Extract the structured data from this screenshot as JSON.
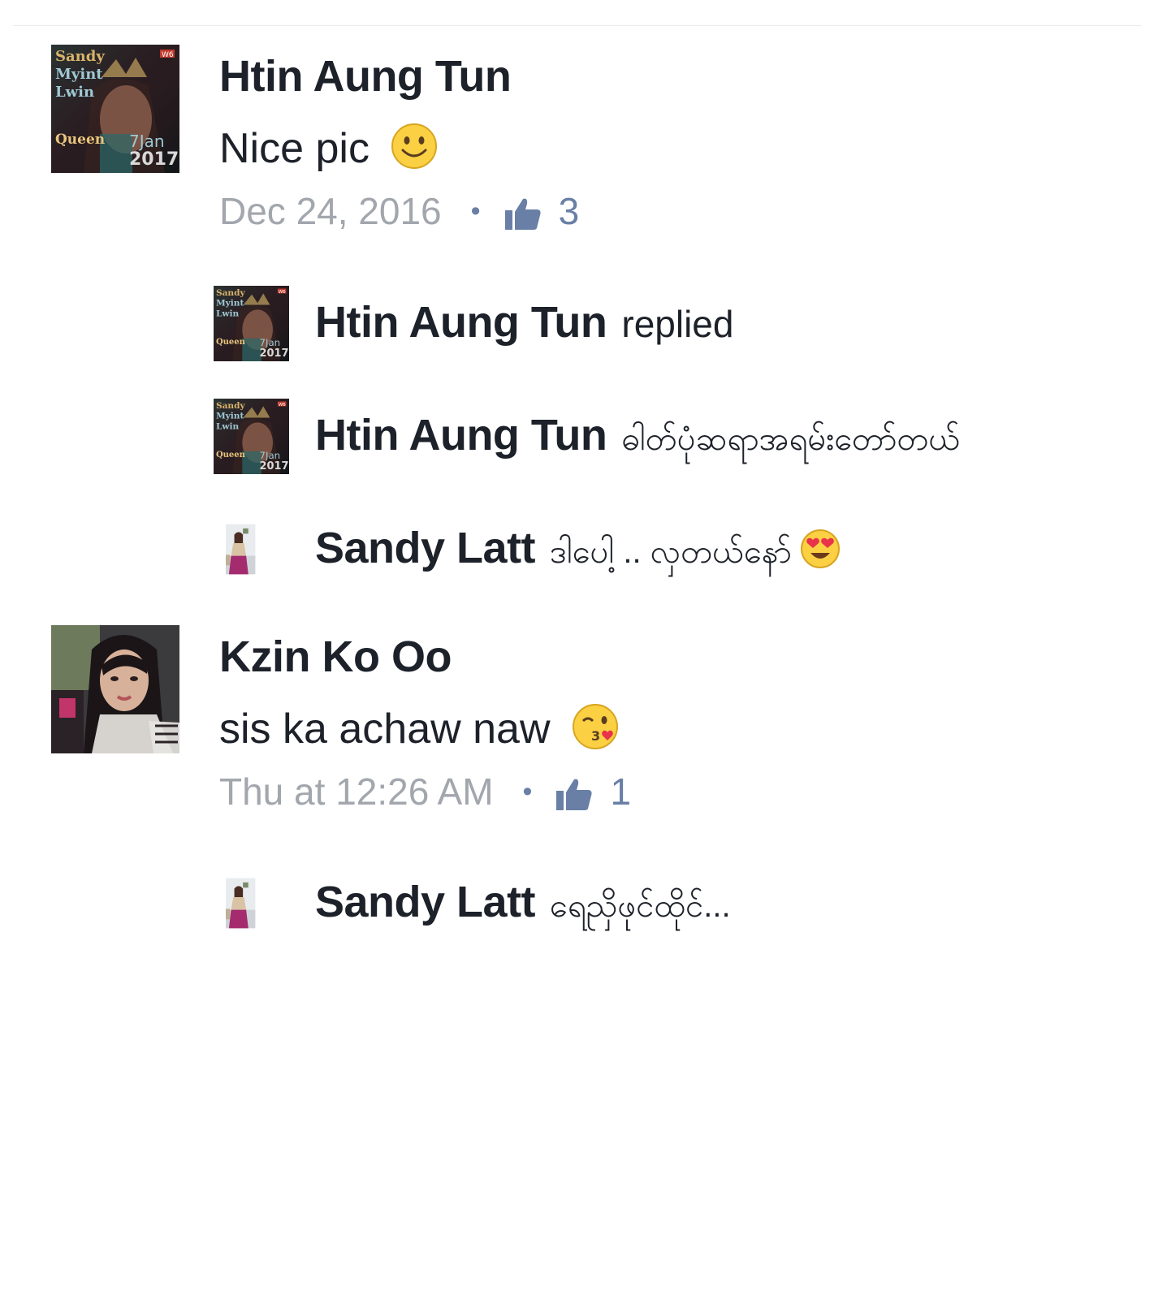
{
  "comments": [
    {
      "author": "Htin Aung Tun",
      "avatar": "album-cover-avatar",
      "text": "Nice pic",
      "emoji": "smiling-face-emoji",
      "time": "Dec 24, 2016",
      "separator": "•",
      "like_icon": "thumbs-up-icon",
      "likes": "3",
      "replies": [
        {
          "author": "Htin Aung Tun",
          "text": "replied",
          "avatar": "album-cover-avatar"
        },
        {
          "author": "Htin Aung Tun",
          "text": "ဓါတ်ပုံဆရာအရမ်းတော်တယ်",
          "avatar": "album-cover-avatar"
        },
        {
          "author": "Sandy Latt",
          "text": "ဒါပေါ့ .. လှတယ်နော်",
          "emoji": "heart-eyes-emoji",
          "avatar": "woman-photo-avatar"
        }
      ]
    },
    {
      "author": "Kzin Ko Oo",
      "avatar": "selfie-avatar",
      "text": "sis ka achaw naw",
      "emoji": "kissing-face-emoji",
      "time": "Thu at 12:26 AM",
      "separator": "•",
      "like_icon": "thumbs-up-icon",
      "likes": "1",
      "replies": [
        {
          "author": "Sandy Latt",
          "text": "ရေညှိဖုင်ထိုင်...",
          "avatar": "woman-photo-avatar"
        }
      ]
    }
  ],
  "album_cover": {
    "title_lines": [
      "Sandy",
      "Myint",
      "Lwin"
    ],
    "subtitle": "Queen",
    "date_line1": "7Jan",
    "date_line2": "2017",
    "badge": "W6"
  },
  "colors": {
    "name": "#1d2129",
    "meta_gray": "#a2a6ad",
    "like_blue": "#697fa6",
    "emoji_yellow": "#fbd043"
  }
}
